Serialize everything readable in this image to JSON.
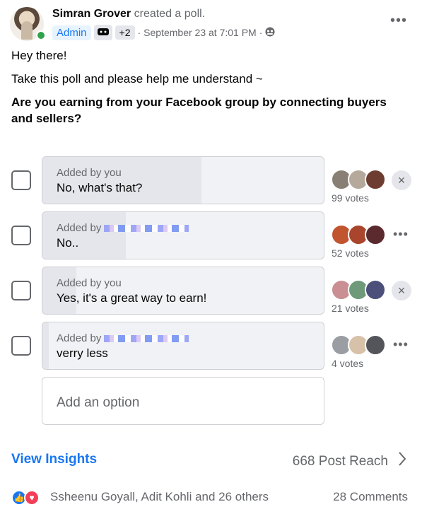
{
  "post": {
    "author": "Simran Grover",
    "action": "created a poll.",
    "role_badge": "Admin",
    "extra_badges": "+2",
    "timestamp": "September 23 at 7:01 PM",
    "separator": "·",
    "privacy_icon": "group-icon",
    "more_label": "•••",
    "greeting": "Hey there!",
    "intro": "Take this poll and please help me understand ~",
    "question": "Are you earning from your Facebook group by connecting buyers and sellers?"
  },
  "poll": {
    "options": [
      {
        "added_by": "Added by you",
        "label": "No, what's that?",
        "votes": "99 votes",
        "share": 0.566,
        "control": "×",
        "control_type": "remove"
      },
      {
        "added_by": "Added by",
        "label": "No..",
        "votes": "52 votes",
        "share": 0.297,
        "control": "•••",
        "control_type": "more"
      },
      {
        "added_by": "Added by you",
        "label": "Yes, it's a great way to earn!",
        "votes": "21 votes",
        "share": 0.12,
        "control": "×",
        "control_type": "remove"
      },
      {
        "added_by": "Added by",
        "label": "verry less",
        "votes": "4 votes",
        "share": 0.023,
        "control": "•••",
        "control_type": "more"
      }
    ],
    "add_option_placeholder": "Add an option"
  },
  "footer": {
    "insights_label": "View Insights",
    "reach_label": "668 Post Reach",
    "reactions_text": "Ssheenu Goyall, Adit Kohli and 26 others",
    "comments_label": "28 Comments"
  },
  "colors": {
    "accent": "#1877f2",
    "online": "#31a24c",
    "love": "#f33e58"
  }
}
